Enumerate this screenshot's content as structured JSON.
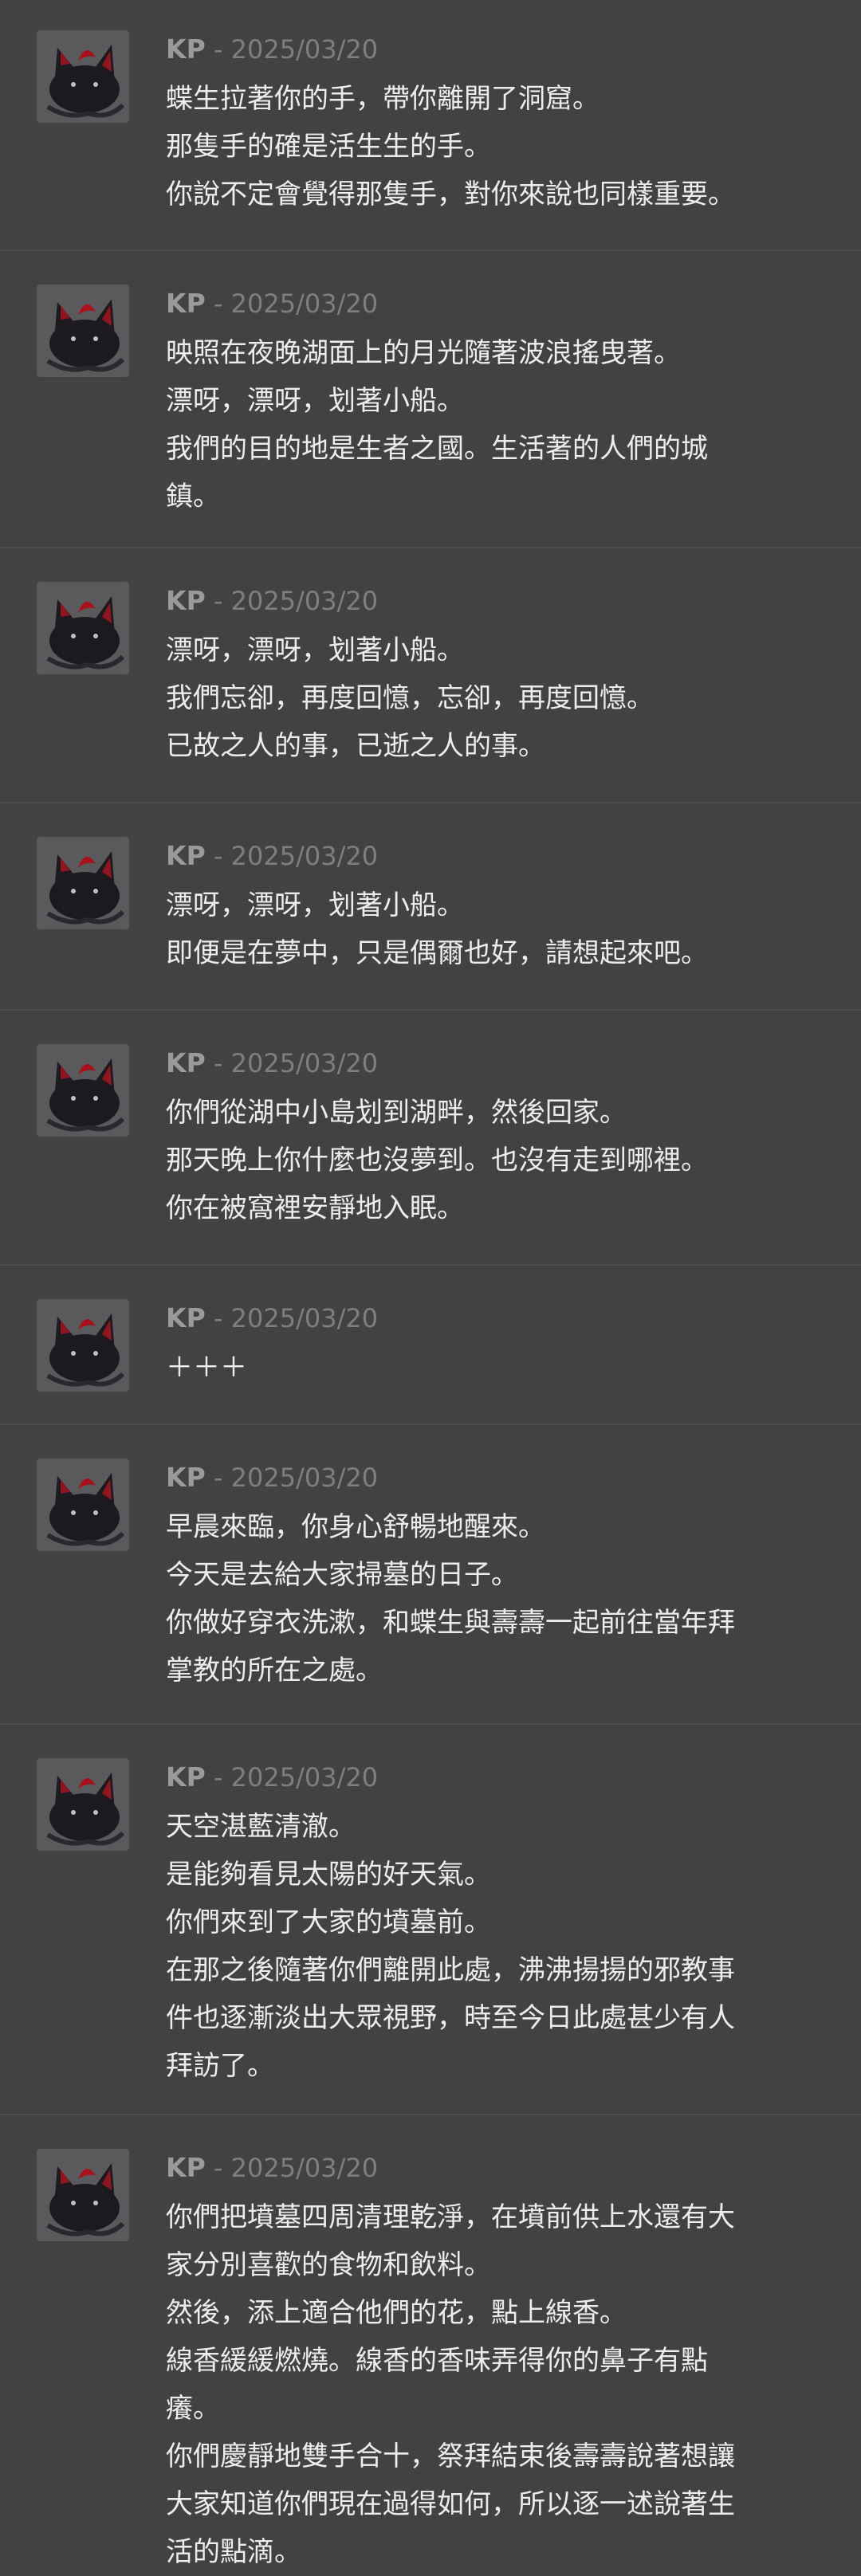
{
  "messages": [
    {
      "author": "KP",
      "separator": " - ",
      "date": "2025/03/20",
      "lines": [
        "蝶生拉著你的手，帶你離開了洞窟。",
        "那隻手的確是活生生的手。",
        "你說不定會覺得那隻手，對你來說也同樣重要。"
      ]
    },
    {
      "author": "KP",
      "separator": " - ",
      "date": "2025/03/20",
      "lines": [
        "映照在夜晚湖面上的月光隨著波浪搖曳著。",
        "漂呀，漂呀，划著小船。",
        "我們的目的地是生者之國。生活著的人們的城",
        "鎮。"
      ]
    },
    {
      "author": "KP",
      "separator": " - ",
      "date": "2025/03/20",
      "lines": [
        "漂呀，漂呀，划著小船。",
        "我們忘卻，再度回憶，忘卻，再度回憶。",
        "已故之人的事，已逝之人的事。"
      ]
    },
    {
      "author": "KP",
      "separator": " - ",
      "date": "2025/03/20",
      "lines": [
        "漂呀，漂呀，划著小船。",
        "即便是在夢中，只是偶爾也好，請想起來吧。"
      ]
    },
    {
      "author": "KP",
      "separator": " - ",
      "date": "2025/03/20",
      "lines": [
        "你們從湖中小島划到湖畔，然後回家。",
        "那天晚上你什麼也沒夢到。也沒有走到哪裡。",
        "你在被窩裡安靜地入眠。"
      ]
    },
    {
      "author": "KP",
      "separator": " - ",
      "date": "2025/03/20",
      "lines": [
        "＋＋＋"
      ]
    },
    {
      "author": "KP",
      "separator": " - ",
      "date": "2025/03/20",
      "lines": [
        "早晨來臨，你身心舒暢地醒來。",
        "今天是去給大家掃墓的日子。",
        "你做好穿衣洗漱，和蝶生與壽壽一起前往當年拜",
        "掌教的所在之處。"
      ]
    },
    {
      "author": "KP",
      "separator": " - ",
      "date": "2025/03/20",
      "lines": [
        "天空湛藍清澈。",
        "是能夠看見太陽的好天氣。",
        "你們來到了大家的墳墓前。",
        "在那之後隨著你們離開此處，沸沸揚揚的邪教事",
        "件也逐漸淡出大眾視野，時至今日此處甚少有人",
        "拜訪了。"
      ]
    },
    {
      "author": "KP",
      "separator": " - ",
      "date": "2025/03/20",
      "lines": [
        "你們把墳墓四周清理乾淨，在墳前供上水還有大",
        "家分別喜歡的食物和飲料。",
        "然後，添上適合他們的花，點上線香。",
        "線香緩緩燃燒。線香的香味弄得你的鼻子有點",
        "癢。",
        "你們慶靜地雙手合十，祭拜結束後壽壽說著想讓",
        "大家知道你們現在過得如何，所以逐一述說著生",
        "活的點滴。"
      ]
    }
  ]
}
